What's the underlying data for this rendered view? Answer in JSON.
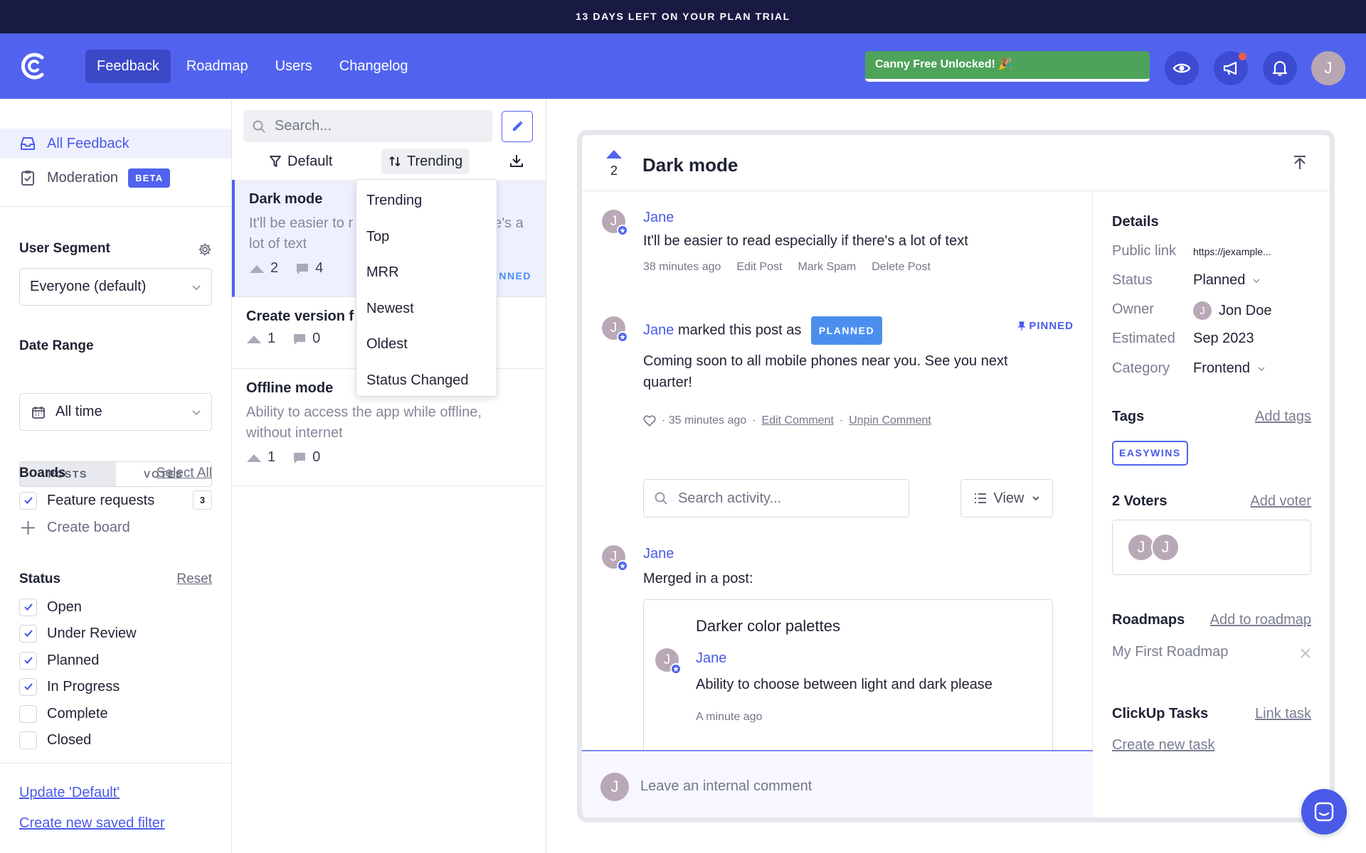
{
  "banner": {
    "text": "13 DAYS LEFT ON YOUR PLAN TRIAL"
  },
  "header": {
    "nav": [
      "Feedback",
      "Roadmap",
      "Users",
      "Changelog"
    ],
    "unlocked_text": "Canny Free Unlocked! 🎉",
    "avatar_initial": "J",
    "colors": {
      "header_bg": "#5163ee",
      "banner_bg": "#191a44",
      "unlocked_bg": "#4ea35a"
    }
  },
  "sidebar": {
    "all_feedback": "All Feedback",
    "moderation": "Moderation",
    "beta_badge": "BETA",
    "user_segment": {
      "heading": "User Segment",
      "value": "Everyone (default)"
    },
    "date_range": {
      "heading": "Date Range",
      "toggle": [
        "POSTS",
        "VOTES"
      ],
      "value": "All time"
    },
    "boards": {
      "heading": "Boards",
      "select_all": "Select All",
      "items": [
        {
          "label": "Feature requests",
          "count": "3",
          "checked": true
        }
      ],
      "create": "Create board"
    },
    "status": {
      "heading": "Status",
      "reset": "Reset",
      "items": [
        {
          "label": "Open",
          "checked": true
        },
        {
          "label": "Under Review",
          "checked": true
        },
        {
          "label": "Planned",
          "checked": true
        },
        {
          "label": "In Progress",
          "checked": true
        },
        {
          "label": "Complete",
          "checked": false
        },
        {
          "label": "Closed",
          "checked": false
        }
      ]
    },
    "update_filter": "Update 'Default'",
    "create_filter": "Create new saved filter"
  },
  "list": {
    "search_placeholder": "Search...",
    "filter_default": "Default",
    "filter_sort": "Trending",
    "posts": [
      {
        "title": "Dark mode",
        "desc_line1": "It'll be easier to r",
        "desc_line1_tail": "e's a",
        "desc_line2": "lot of text",
        "votes": "2",
        "comments": "4",
        "status": "NNED"
      },
      {
        "title": "Create version f",
        "votes": "1",
        "comments": "0"
      },
      {
        "title": "Offline mode",
        "desc_line1": "Ability to access the app while offline,",
        "desc_line2": "without internet",
        "votes": "1",
        "comments": "0"
      }
    ],
    "sort_options": [
      "Trending",
      "Top",
      "MRR",
      "Newest",
      "Oldest",
      "Status Changed"
    ]
  },
  "detail": {
    "votes": "2",
    "title": "Dark mode",
    "post": {
      "author": "Jane",
      "avatar": "J",
      "body": "It'll be easier to read especially if there's a lot of text",
      "time": "38 minutes ago",
      "actions": [
        "Edit Post",
        "Mark Spam",
        "Delete Post"
      ]
    },
    "status_comment": {
      "author": "Jane",
      "action_text": "marked this post as",
      "badge": "PLANNED",
      "pinned": "PINNED",
      "body_line1": "Coming soon to all mobile phones near you. See you next",
      "body_line2": "quarter!",
      "time": "· 35 minutes ago",
      "edit": "Edit Comment",
      "unpin": "Unpin Comment"
    },
    "activity_search_placeholder": "Search activity...",
    "view_label": "View",
    "merge": {
      "author": "Jane",
      "text": "Merged in a post:",
      "card_title": "Darker color palettes",
      "card_author": "Jane",
      "card_body": "Ability to choose between light and dark please",
      "card_time": "A minute ago"
    },
    "comment_placeholder": "Leave an internal comment"
  },
  "details_panel": {
    "heading": "Details",
    "rows": [
      {
        "label": "Public link",
        "value": "https://jexample..."
      },
      {
        "label": "Status",
        "value": "Planned"
      },
      {
        "label": "Owner",
        "value": "Jon Doe",
        "avatar": "J"
      },
      {
        "label": "Estimated",
        "value": "Sep 2023"
      },
      {
        "label": "Category",
        "value": "Frontend"
      }
    ],
    "tags": {
      "heading": "Tags",
      "add": "Add tags",
      "chip": "EASYWINS"
    },
    "voters": {
      "heading": "2 Voters",
      "add": "Add voter",
      "avatars": [
        "J",
        "J"
      ]
    },
    "roadmaps": {
      "heading": "Roadmaps",
      "add": "Add to roadmap",
      "item": "My First Roadmap"
    },
    "clickup": {
      "heading": "ClickUp Tasks",
      "link": "Link task",
      "create": "Create new task"
    }
  }
}
